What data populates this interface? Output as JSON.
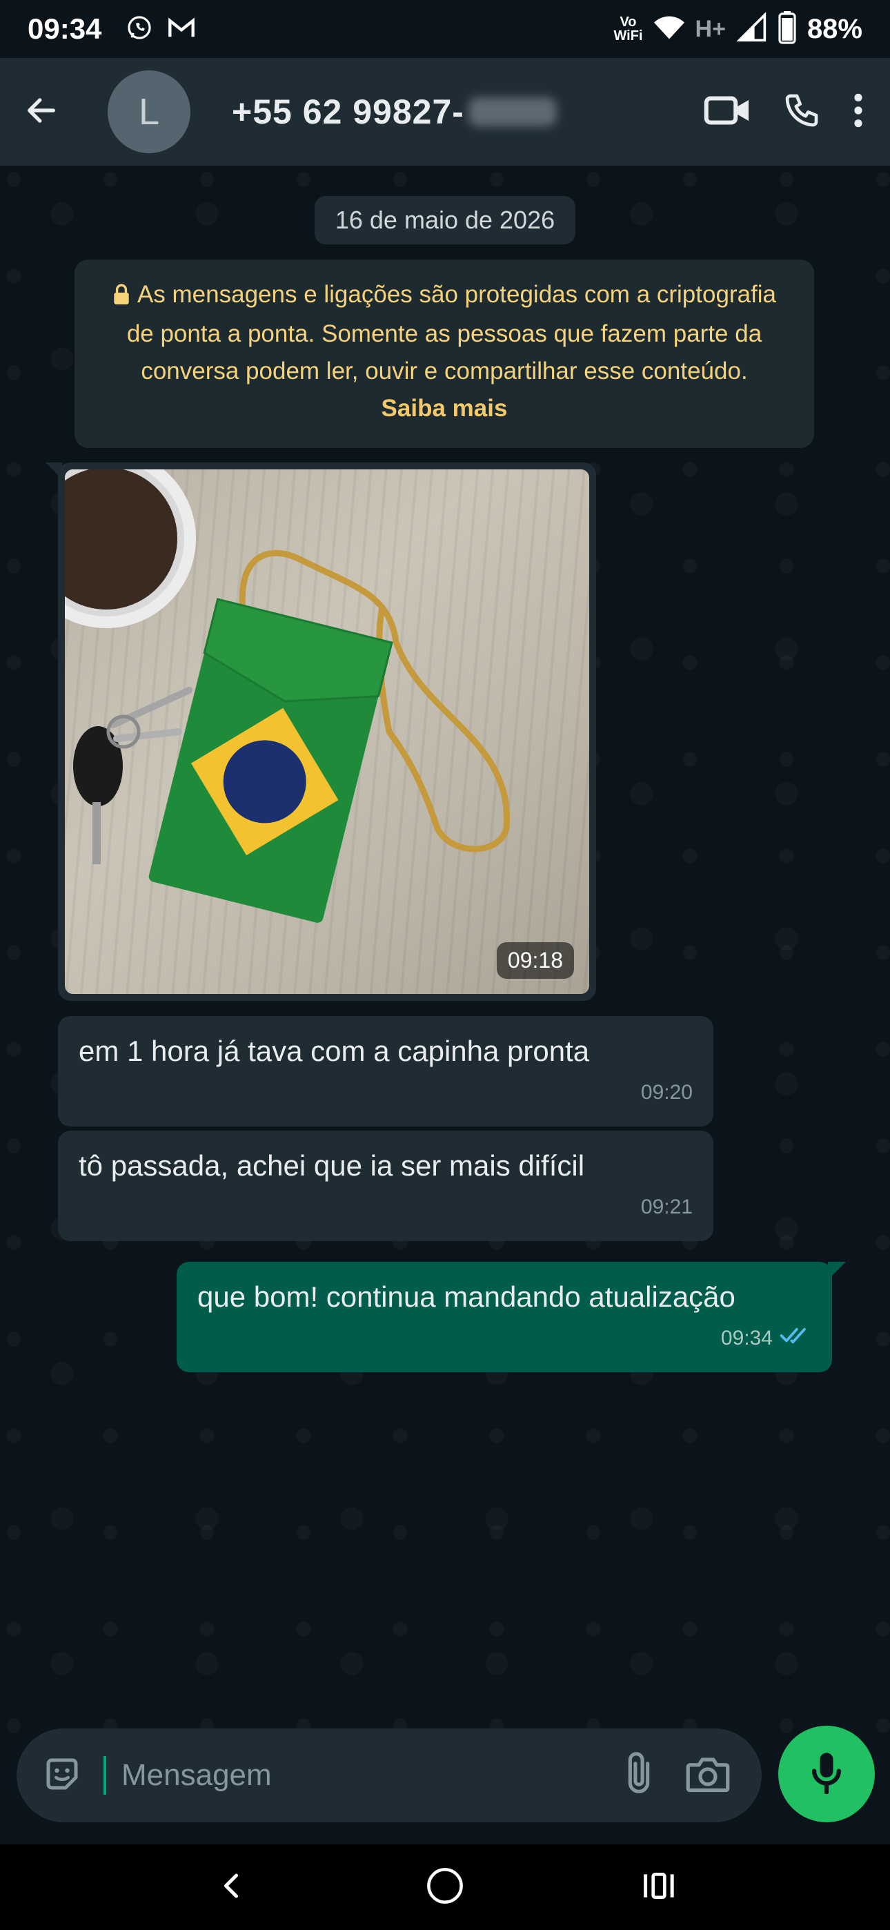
{
  "status_bar": {
    "time": "09:34",
    "notification_icons": [
      "whatsapp-icon",
      "gmail-icon"
    ],
    "vowifi": "Vo\nWiFi",
    "network": "H+",
    "battery": "88%"
  },
  "header": {
    "avatar_letter": "L",
    "contact_number": "+55 62 99827-",
    "icons": [
      "back-arrow-icon",
      "video-call-icon",
      "voice-call-icon",
      "more-options-icon"
    ]
  },
  "chat": {
    "date_chip": "16 de maio de 2026",
    "encryption_text": "As mensagens e ligações são protegidas com a criptografia de ponta a ponta. Somente as pessoas que fazem parte da conversa podem ler, ouvir e compartilhar esse conteúdo.",
    "encryption_link": "Saiba mais",
    "image_message": {
      "time": "09:18"
    },
    "messages": [
      {
        "direction": "incoming",
        "text": "em 1 hora já tava com a capinha pronta",
        "time": "09:20"
      },
      {
        "direction": "incoming",
        "text": "tô passada, achei que ia ser mais difícil",
        "time": "09:21"
      },
      {
        "direction": "outgoing",
        "text": "que bom! continua mandando atualização",
        "time": "09:34",
        "status": "read"
      }
    ]
  },
  "composer": {
    "placeholder": "Mensagem",
    "icons": [
      "emoji-sticker-icon",
      "attach-icon",
      "camera-icon",
      "mic-icon"
    ]
  },
  "colors": {
    "background": "#0b141a",
    "header": "#1f2c34",
    "incoming_bubble": "#1f2c34",
    "outgoing_bubble": "#005c4b",
    "accent_green": "#21c063",
    "read_ticks": "#53bdeb",
    "encryption_text": "#f6d27a"
  }
}
